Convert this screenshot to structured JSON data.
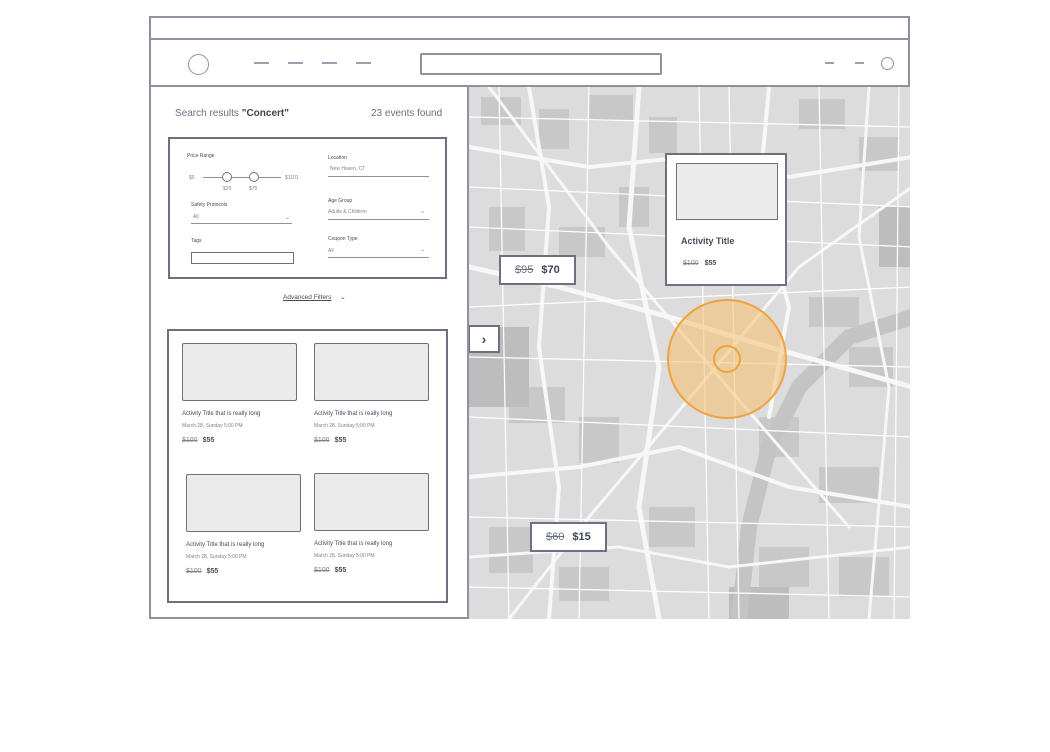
{
  "search": {
    "prefix": "Search results ",
    "query": "\"Concert\"",
    "count": "23 events found"
  },
  "filters": {
    "price_range": {
      "label": "Price Range",
      "min": "$0",
      "max": "$1101",
      "low_thumb": "$25",
      "high_thumb": "$75"
    },
    "location": {
      "label": "Location",
      "value": "New Haven, CT"
    },
    "safety": {
      "label": "Safety Protocols",
      "value": "All"
    },
    "age_group": {
      "label": "Age Group",
      "value": "Adults & Children"
    },
    "tags": {
      "label": "Tags"
    },
    "coupon": {
      "label": "Coupon Type",
      "value": "All"
    },
    "advanced": "Advanced Filters"
  },
  "cards": [
    {
      "title": "Activity Title that is really long",
      "date": "March 28, Sunday 5:00 PM",
      "old_price": "$100",
      "price": "$55"
    },
    {
      "title": "Activity Title that is really long",
      "date": "March 28, Sunday 5:00 PM",
      "old_price": "$100",
      "price": "$55"
    },
    {
      "title": "Activity Title that is really long",
      "date": "March 28, Sunday 5:00 PM",
      "old_price": "$100",
      "price": "$55"
    },
    {
      "title": "Activity Title that is really long",
      "date": "March 28, Sunday 5:00 PM",
      "old_price": "$100",
      "price": "$55"
    }
  ],
  "map": {
    "toggle_icon": "chevron-right",
    "pins": [
      {
        "old_price": "$95",
        "price": "$70"
      },
      {
        "old_price": "$60",
        "price": "$15"
      }
    ],
    "popup": {
      "title": "Activity Title",
      "old_price": "$100",
      "price": "$55"
    },
    "radius_color": "#f0a23c"
  },
  "colors": {
    "outline": "#8d929e",
    "text": "#454c5a",
    "map_bg": "#d9d9d9",
    "accent": "#f0a23c"
  }
}
